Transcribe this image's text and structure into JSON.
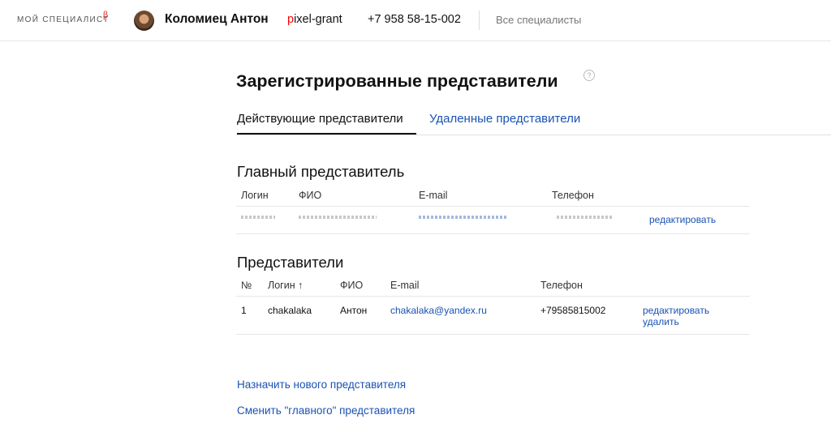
{
  "header": {
    "brand": "МОЙ СПЕЦИАЛИСТ",
    "beta": "β",
    "user_name": "Коломиец Антон",
    "client_login_first": "p",
    "client_login_rest": "ixel-grant",
    "phone": "+7 958 58-15-002",
    "all_specialists": "Все специалисты"
  },
  "page": {
    "title": "Зарегистрированные представители",
    "help": "?"
  },
  "tabs": {
    "active": "Действующие представители",
    "deleted": "Удаленные представители"
  },
  "main_rep": {
    "title": "Главный представитель",
    "columns": [
      "Логин",
      "ФИО",
      "E-mail",
      "Телефон"
    ],
    "edit": "редактировать"
  },
  "reps": {
    "title": "Представители",
    "columns": [
      "№",
      "Логин ↑",
      "ФИО",
      "E-mail",
      "Телефон"
    ],
    "rows": [
      {
        "num": "1",
        "login": "chakalaka",
        "name": "Антон",
        "email": "chakalaka@yandex.ru",
        "phone": "+79585815002",
        "edit": "редактировать",
        "delete": "удалить"
      }
    ]
  },
  "actions": {
    "assign_new": "Назначить нового представителя",
    "change_main": "Сменить \"главного\" представителя"
  },
  "colors": {
    "link": "#1a52b3",
    "brand_accent": "#ff0000"
  }
}
